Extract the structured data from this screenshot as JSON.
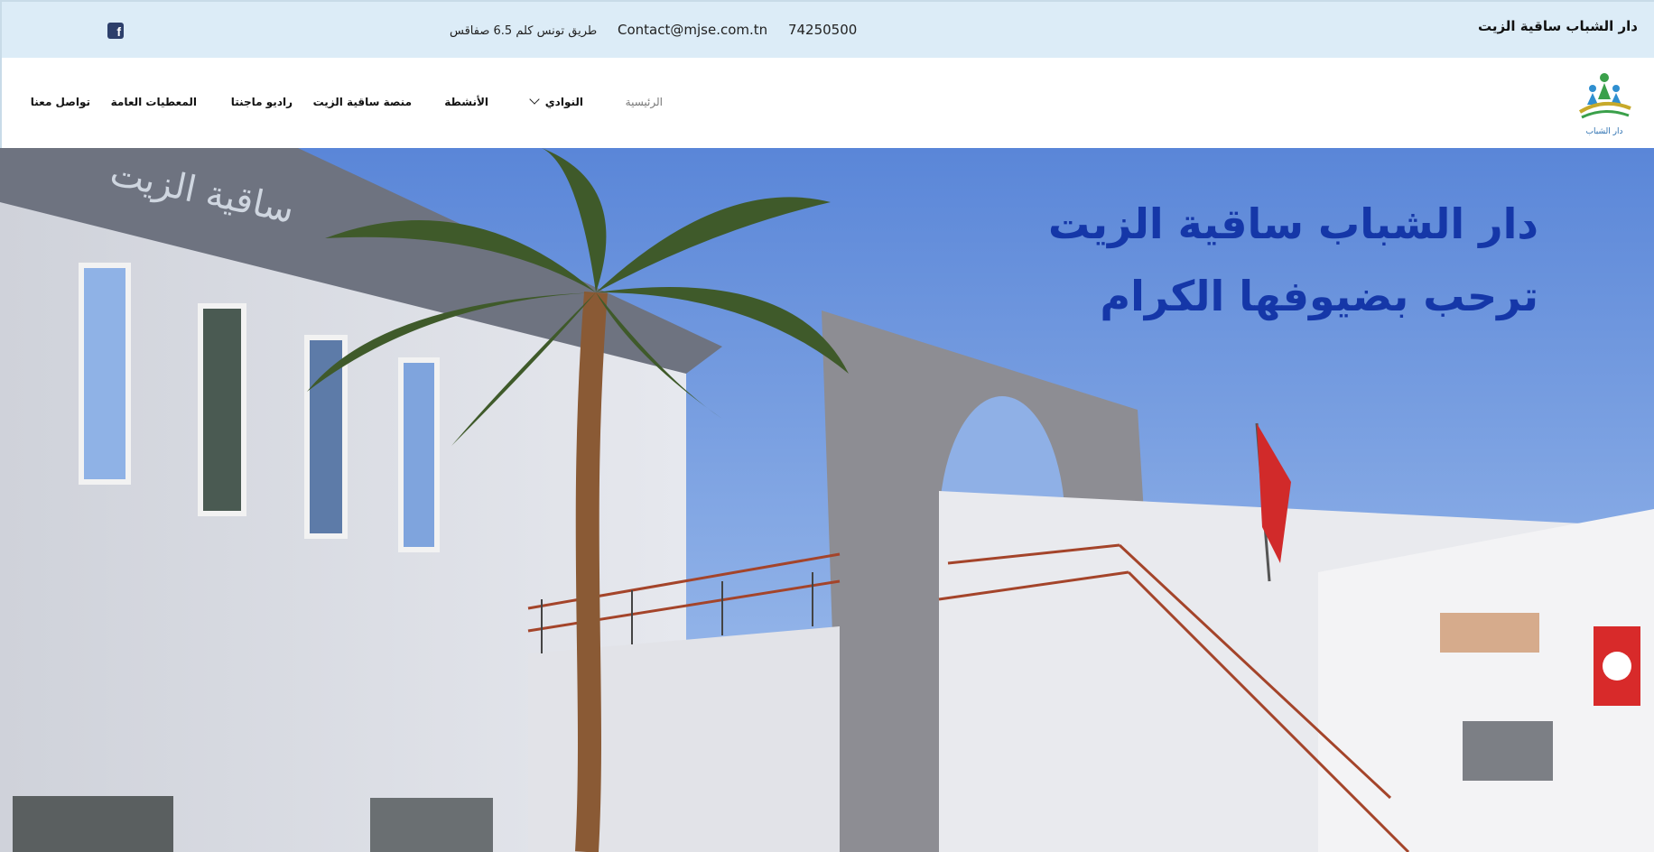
{
  "topbar": {
    "site_name": "دار الشباب ساقية الزيت",
    "phone": "74250500",
    "email": "Contact@mjse.com.tn",
    "address": "طريق تونس كلم 6.5 صفاقس",
    "social_icon": "facebook-icon"
  },
  "nav": {
    "items": [
      {
        "label": "الرئيسية"
      },
      {
        "label": "النوادي"
      },
      {
        "label": "الأنشطة"
      },
      {
        "label": "منصة ساقية الزيت"
      },
      {
        "label": "راديو ماجنتا"
      },
      {
        "label": "المعطيات العامة"
      },
      {
        "label": "تواصل معنا"
      }
    ]
  },
  "hero": {
    "line1": "دار الشباب ساقية الزيت",
    "line2": "ترحب بضيوفها الكرام",
    "building_sign": "ساقية الزيت"
  },
  "colors": {
    "topbar_bg": "#dcecf7",
    "hero_text": "#1537a8",
    "sky": "#6f98e0"
  }
}
